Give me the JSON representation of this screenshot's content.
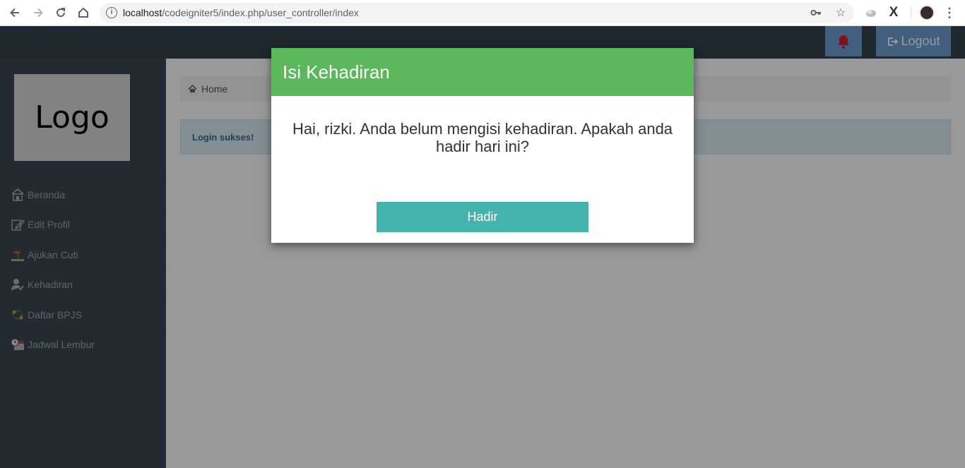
{
  "browser": {
    "url_host": "localhost",
    "url_path": "/codeigniter5/index.php/user_controller/index",
    "icons": [
      "back-icon",
      "forward-icon",
      "reload-icon",
      "home-icon",
      "info-icon",
      "key-icon",
      "star-icon",
      "extension-icon",
      "x-extension-icon",
      "menu-icon"
    ]
  },
  "topbar": {
    "logout_label": "Logout"
  },
  "sidebar": {
    "logo_text": "Logo",
    "items": [
      {
        "label": "Beranda",
        "icon": "house-icon"
      },
      {
        "label": "Edit Profil",
        "icon": "edit-icon"
      },
      {
        "label": "Ajukan Cuti",
        "icon": "beach-icon"
      },
      {
        "label": "Kehadiran",
        "icon": "user-check-icon"
      },
      {
        "label": "Daftar BPJS",
        "icon": "exchange-icon"
      },
      {
        "label": "Jadwal Lembur",
        "icon": "calendar-clock-icon"
      }
    ]
  },
  "main": {
    "breadcrumb": "Home",
    "alert": "Login sukses!"
  },
  "modal": {
    "title": "Isi Kehadiran",
    "message": "Hai, rizki. Anda belum mengisi kehadiran. Apakah anda hadir hari ini?",
    "button_label": "Hadir"
  },
  "colors": {
    "modal_header": "#5cb85c",
    "modal_button": "#46b4ae",
    "topbar": "#35414f",
    "sidebar": "#3b4653",
    "bell": "#d9202a"
  }
}
